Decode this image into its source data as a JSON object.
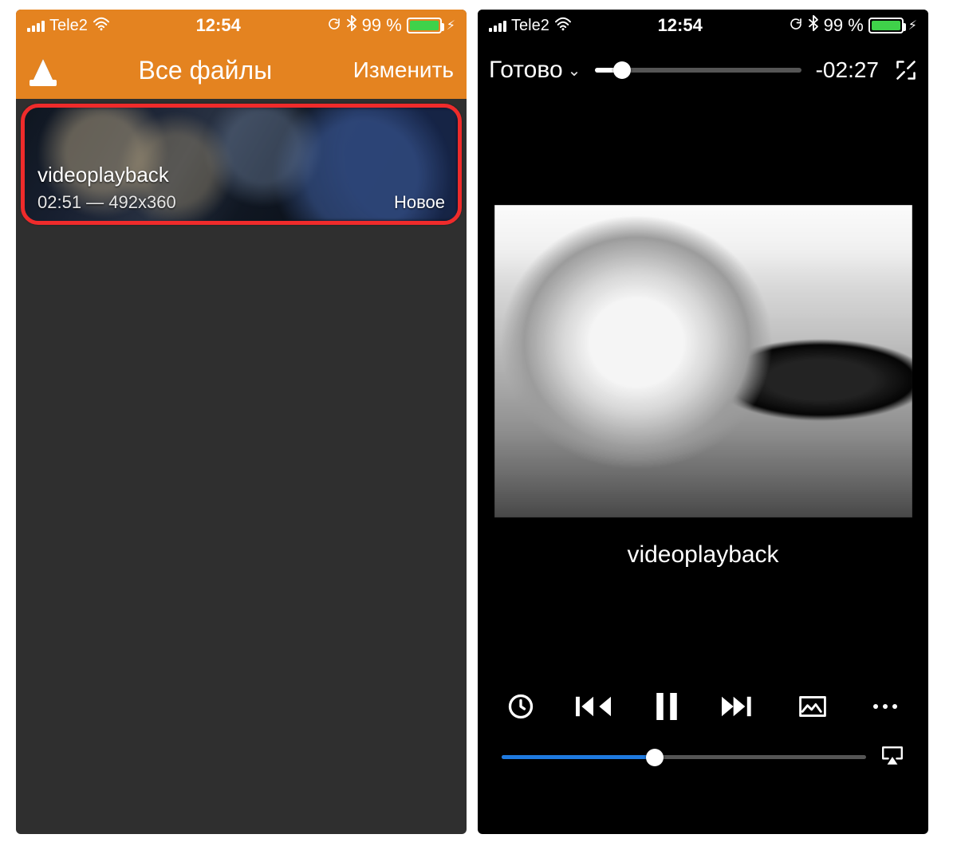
{
  "colors": {
    "vlc_orange": "#e48320",
    "highlight_red": "#ef2b2b",
    "battery_green": "#3fd24a",
    "accent_blue": "#1f7ae0"
  },
  "status": {
    "carrier": "Tele2",
    "time": "12:54",
    "battery_text": "99 %"
  },
  "library": {
    "title": "Все файлы",
    "edit_label": "Изменить",
    "item": {
      "filename": "videoplayback",
      "meta": "02:51 — 492x360",
      "badge": "Новое"
    }
  },
  "player": {
    "done_label": "Готово",
    "time_remaining": "-02:27",
    "seek_progress_pct": 13,
    "title": "videoplayback",
    "volume_pct": 42
  }
}
